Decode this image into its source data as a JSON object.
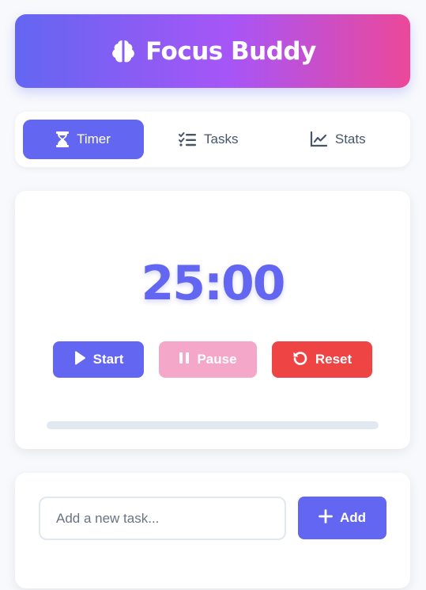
{
  "header": {
    "title": "Focus Buddy",
    "icon": "brain-icon"
  },
  "tabs": [
    {
      "label": "Timer",
      "icon": "hourglass-icon",
      "active": true
    },
    {
      "label": "Tasks",
      "icon": "task-list-icon",
      "active": false
    },
    {
      "label": "Stats",
      "icon": "chart-line-icon",
      "active": false
    }
  ],
  "timer": {
    "display": "25:00",
    "progress_percent": 0,
    "buttons": {
      "start": "Start",
      "pause": "Pause",
      "reset": "Reset"
    }
  },
  "tasks": {
    "input_value": "",
    "input_placeholder": "Add a new task...",
    "add_label": "Add"
  },
  "colors": {
    "primary": "#6366f1",
    "pause": "#f4a7c9",
    "reset": "#ef4444",
    "gradient_start": "#6366f1",
    "gradient_end": "#ec4899"
  }
}
